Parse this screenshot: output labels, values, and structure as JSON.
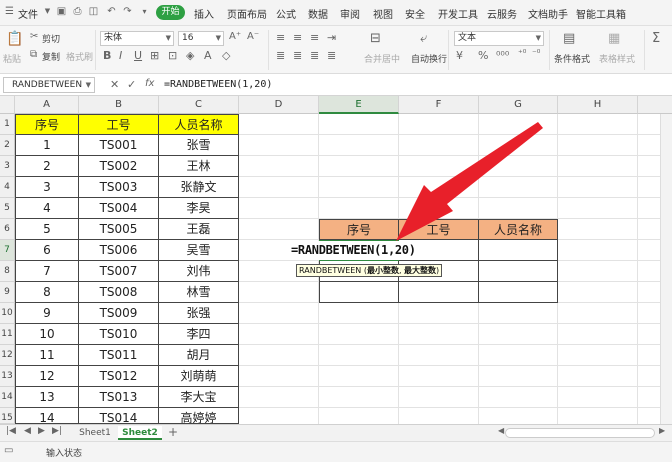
{
  "menu": {
    "file": "文件",
    "start": "开始",
    "tabs": [
      "插入",
      "页面布局",
      "公式",
      "数据",
      "审阅",
      "视图",
      "安全",
      "开发工具",
      "云服务",
      "文档助手",
      "智能工具箱"
    ]
  },
  "ribbon": {
    "paste": "粘贴",
    "cut": "剪切",
    "copy": "复制",
    "format_painter": "格式刷",
    "font_name": "宋体",
    "font_size": "16",
    "merge_center": "合并居中",
    "auto_wrap": "自动换行",
    "number_format": "文本",
    "conditional_format": "条件格式",
    "table_style": "表格样式"
  },
  "formula_bar": {
    "name_box": "RANDBETWEEN",
    "formula": "=RANDBETWEEN(1,20)"
  },
  "columns": [
    "A",
    "B",
    "C",
    "D",
    "E",
    "F",
    "G",
    "H"
  ],
  "rows": [
    "1",
    "2",
    "3",
    "4",
    "5",
    "6",
    "7",
    "8",
    "9",
    "10",
    "11",
    "12",
    "13",
    "14",
    "15"
  ],
  "table_main": {
    "headers": [
      "序号",
      "工号",
      "人员名称"
    ],
    "rows": [
      [
        "1",
        "TS001",
        "张雪"
      ],
      [
        "2",
        "TS002",
        "王林"
      ],
      [
        "3",
        "TS003",
        "张静文"
      ],
      [
        "4",
        "TS004",
        "李昊"
      ],
      [
        "5",
        "TS005",
        "王磊"
      ],
      [
        "6",
        "TS006",
        "吴雪"
      ],
      [
        "7",
        "TS007",
        "刘伟"
      ],
      [
        "8",
        "TS008",
        "林雪"
      ],
      [
        "9",
        "TS009",
        "张强"
      ],
      [
        "10",
        "TS010",
        "李四"
      ],
      [
        "11",
        "TS011",
        "胡月"
      ],
      [
        "12",
        "TS012",
        "刘萌萌"
      ],
      [
        "13",
        "TS013",
        "李大宝"
      ],
      [
        "14",
        "TS014",
        "高婷婷"
      ]
    ]
  },
  "table_lookup": {
    "headers": [
      "序号",
      "工号",
      "人员名称"
    ]
  },
  "edit_cell": {
    "formula": "=RANDBETWEEN(1,20)",
    "tooltip_prefix": "RANDBETWEEN (",
    "tooltip_arg1": "最小整数",
    "tooltip_sep": ", ",
    "tooltip_arg2": "最大整数",
    "tooltip_suffix": ")"
  },
  "sheets": [
    "Sheet1",
    "Sheet2"
  ],
  "status": {
    "mode": "输入状态"
  },
  "colors": {
    "accent": "#2ea043",
    "header_yellow": "#ffff00",
    "header_orange": "#f4b183",
    "arrow_red": "#e8202a"
  }
}
